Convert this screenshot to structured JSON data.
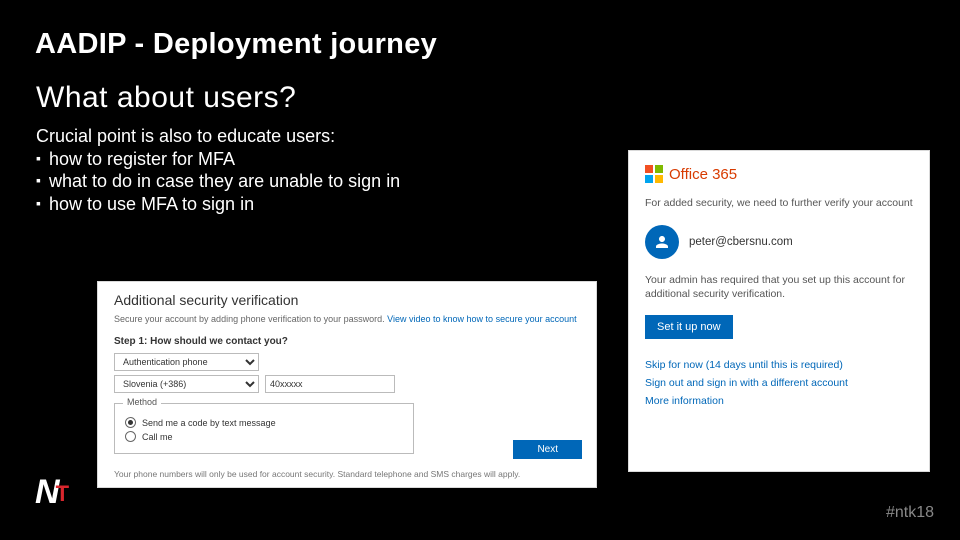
{
  "slide": {
    "title": "AADIP - Deployment journey",
    "sub_heading": "What about users?",
    "intro": "Crucial point is also to educate users:",
    "bullets": [
      "how to register for MFA",
      "what to do in case they are unable to sign in",
      "how to use MFA to sign in"
    ],
    "hashtag": "#ntk18",
    "logo_n": "N",
    "logo_t": "T"
  },
  "left_shot": {
    "title": "Additional security verification",
    "desc_prefix": "Secure your account by adding phone verification to your password. ",
    "desc_link": "View video to know how to secure your account",
    "step_label": "Step 1: How should we contact you?",
    "contact_method_selected": "Authentication phone",
    "country_selected": "Slovenia (+386)",
    "phone_value": "40xxxxx",
    "method_legend": "Method",
    "radio_sms": "Send me a code by text message",
    "radio_call": "Call me",
    "next_button": "Next",
    "footnote": "Your phone numbers will only be used for account security. Standard telephone and SMS charges will apply."
  },
  "right_shot": {
    "brand": "Office 365",
    "security_msg": "For added security, we need to further verify your account",
    "user_email": "peter@cbersnu.com",
    "admin_msg": "Your admin has required that you set up this account for additional security verification.",
    "setup_button": "Set it up now",
    "link_skip": "Skip for now (14 days until this is required)",
    "link_signout": "Sign out and sign in with a different account",
    "link_more": "More information"
  }
}
